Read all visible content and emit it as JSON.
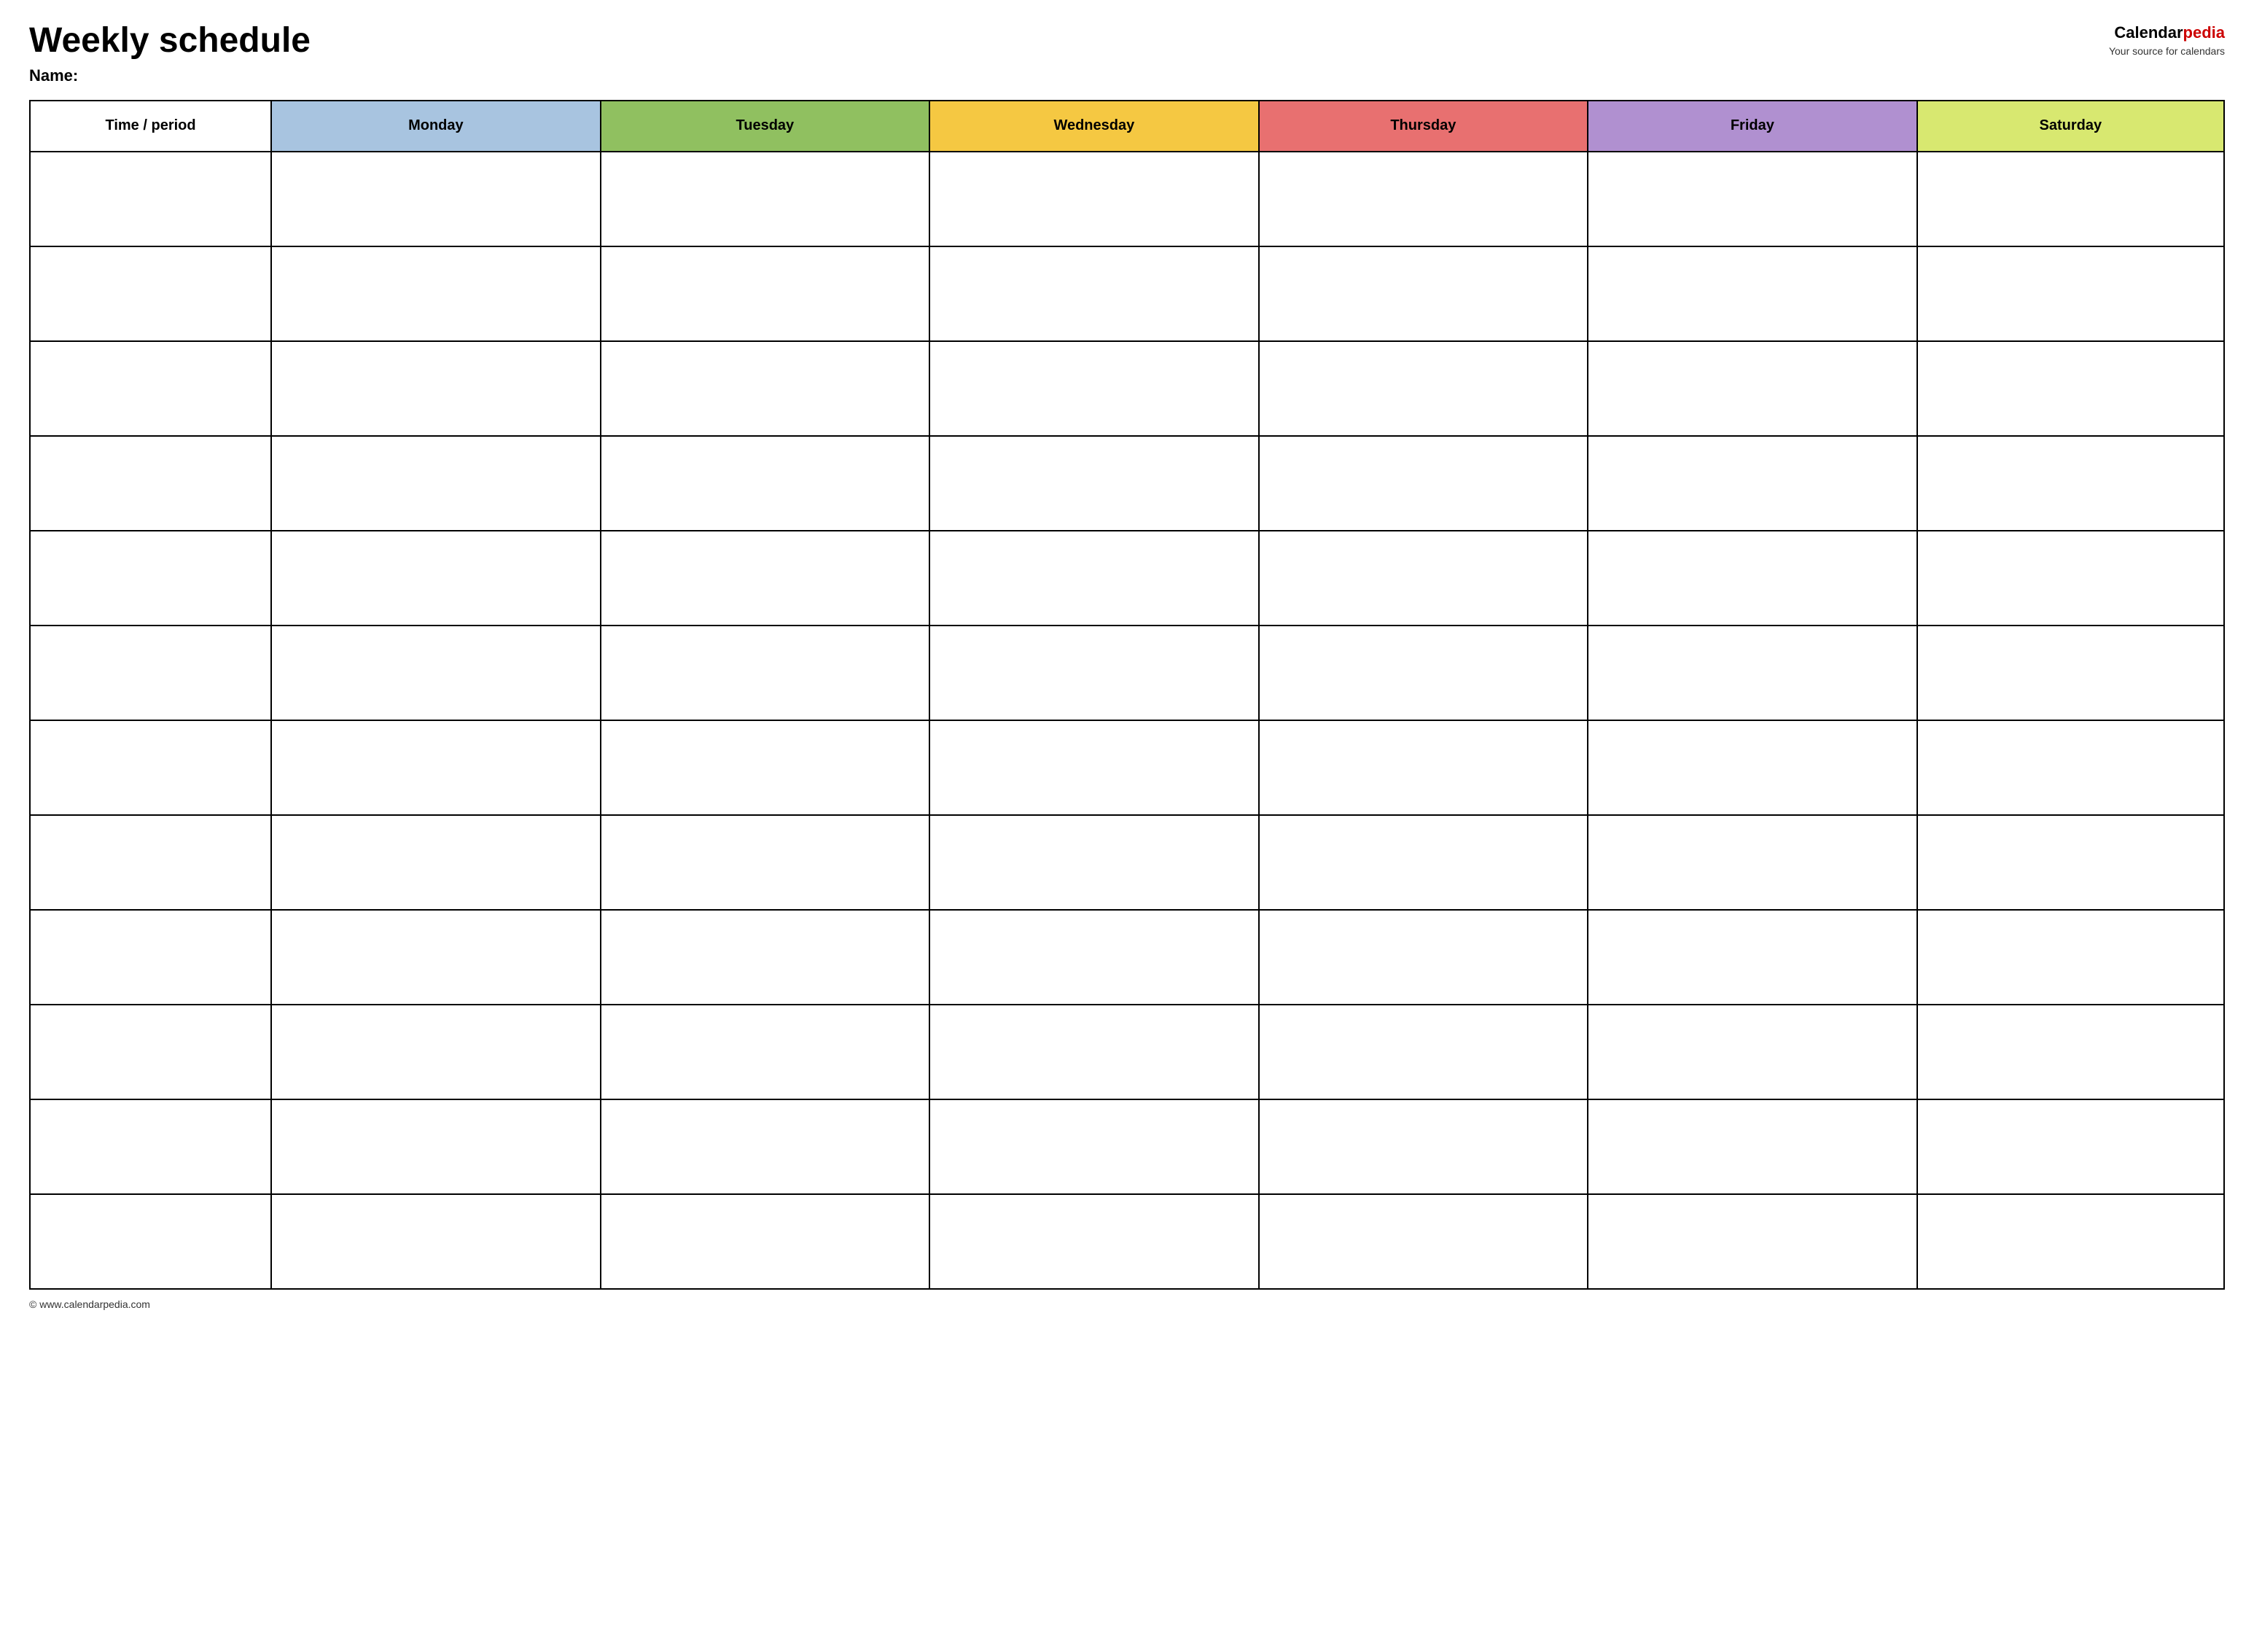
{
  "header": {
    "title": "Weekly schedule",
    "name_label": "Name:",
    "logo_calendar": "Calendar",
    "logo_pedia": "pedia",
    "logo_tagline": "Your source for calendars"
  },
  "table": {
    "headers": [
      {
        "label": "Time / period",
        "color": "#ffffff",
        "class": "col-time"
      },
      {
        "label": "Monday",
        "color": "#a8c4e0",
        "class": "col-monday"
      },
      {
        "label": "Tuesday",
        "color": "#90c060",
        "class": "col-tuesday"
      },
      {
        "label": "Wednesday",
        "color": "#f5c842",
        "class": "col-wednesday"
      },
      {
        "label": "Thursday",
        "color": "#e87070",
        "class": "col-thursday"
      },
      {
        "label": "Friday",
        "color": "#b090d0",
        "class": "col-friday"
      },
      {
        "label": "Saturday",
        "color": "#d8e870",
        "class": "col-saturday"
      }
    ],
    "row_count": 12
  },
  "footer": {
    "url": "© www.calendarpedia.com"
  }
}
